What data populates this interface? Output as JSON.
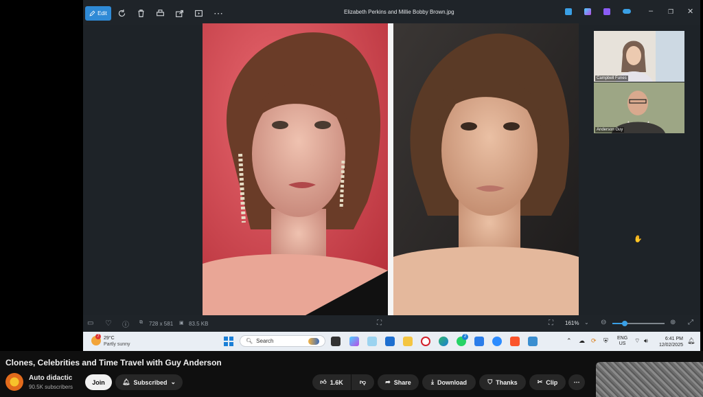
{
  "photos_app": {
    "edit_label": "Edit",
    "window_title": "Elizabeth Perkins and Millie Bobby Brown.jpg",
    "dimensions": "728 x 581",
    "file_size": "83.5 KB",
    "zoom": "161%"
  },
  "meeting": {
    "participants": [
      {
        "name": "Campbell Funes"
      },
      {
        "name": "Anderson Guy"
      }
    ]
  },
  "taskbar": {
    "weather_temp": "29°C",
    "weather_desc": "Partly sunny",
    "weather_badge": "7",
    "search_placeholder": "Search",
    "whatsapp_badge": "2",
    "lang": "ENG",
    "region": "US",
    "time": "6:41 PM",
    "date": "12/02/2025"
  },
  "video": {
    "title": "Clones, Celebrities and Time Travel with Guy Anderson",
    "channel": "Auto didactic",
    "subscribers": "90.5K subscribers",
    "join_label": "Join",
    "subscribed_label": "Subscribed",
    "likes": "1.6K",
    "share_label": "Share",
    "download_label": "Download",
    "thanks_label": "Thanks",
    "clip_label": "Clip"
  },
  "colors": {
    "accent_blue": "#2f8ad6",
    "page_bg": "#0f0f0f",
    "pill_bg": "#272727"
  }
}
